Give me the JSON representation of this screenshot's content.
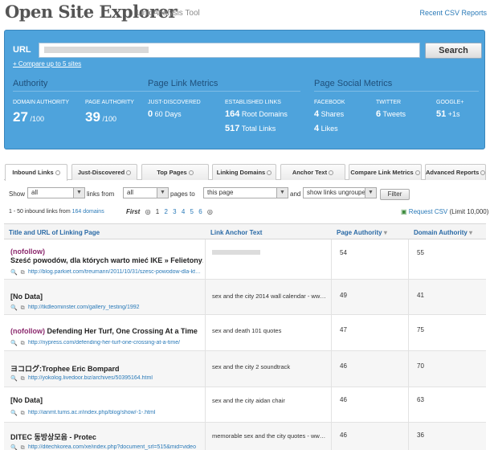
{
  "header": {
    "logo": "Open Site Explorer",
    "tagline": "Link Analysis Tool",
    "recent_csv": "Recent CSV Reports"
  },
  "search": {
    "url_label": "URL",
    "button": "Search",
    "compare": "+ Compare up to 5 sites"
  },
  "metrics": {
    "authority": {
      "title": "Authority",
      "domain_label": "DOMAIN AUTHORITY",
      "domain_value": "27",
      "domain_max": "/100",
      "page_label": "PAGE AUTHORITY",
      "page_value": "39",
      "page_max": "/100"
    },
    "page_link": {
      "title": "Page Link Metrics",
      "just_label": "JUST-DISCOVERED",
      "just_value": "0",
      "just_unit": "60 Days",
      "est_label": "ESTABLISHED LINKS",
      "root_value": "164",
      "root_unit": "Root Domains",
      "total_value": "517",
      "total_unit": "Total Links"
    },
    "social": {
      "title": "Page Social Metrics",
      "fb_label": "FACEBOOK",
      "fb_shares": "4",
      "fb_shares_unit": "Shares",
      "fb_likes": "4",
      "fb_likes_unit": "Likes",
      "tw_label": "TWITTER",
      "tw_value": "6",
      "tw_unit": "Tweets",
      "gp_label": "GOOGLE+",
      "gp_value": "51",
      "gp_unit": "+1s"
    }
  },
  "tabs": [
    "Inbound Links",
    "Just-Discovered",
    "Top Pages",
    "Linking Domains",
    "Anchor Text",
    "Compare Link Metrics",
    "Advanced Reports"
  ],
  "filters": {
    "show": "Show",
    "sel1": "all",
    "links_from": "links from",
    "sel2": "all",
    "pages_to": "pages to",
    "sel3": "this page",
    "and": "and",
    "sel4": "show links ungroupe",
    "filter_btn": "Filter"
  },
  "results": {
    "count_text": "1 - 50 inbound links from",
    "domains_link": "164 domains",
    "first": "First",
    "pages": [
      "1",
      "2",
      "3",
      "4",
      "5",
      "6"
    ],
    "request_csv": "Request CSV",
    "limit": "(Limit 10,000)"
  },
  "columns": [
    "Title and URL of Linking Page",
    "Link Anchor Text",
    "Page Authority",
    "Domain Authority"
  ],
  "rows": [
    {
      "prefix": "(nofollow)",
      "title": "Sześć powodów, dla których warto mieć IKE » Felietony…",
      "url": "http://blog.parkiet.com/treumann/2011/10/31/szesc-powodow-dla-kt…",
      "anchor": "",
      "pa": "54",
      "da": "55"
    },
    {
      "prefix": "",
      "title": "[No Data]",
      "url": "http://tkdleominster.com/gallery_testing/1992",
      "anchor": "sex and the city 2014 wall calendar - ww…",
      "pa": "49",
      "da": "41"
    },
    {
      "prefix": "(nofollow)",
      "title": "Defending Her Turf, One Crossing At a Time",
      "url": "http://nypress.com/defending-her-turf-one-crossing-at-a-time/",
      "anchor": "sex and death 101 quotes",
      "pa": "47",
      "da": "75"
    },
    {
      "prefix": "",
      "title": "ヨコログ:Trophee Eric Bompard",
      "url": "http://yokolog.livedoor.biz/archives/50395164.html",
      "anchor": "sex and the city 2 soundtrack",
      "pa": "46",
      "da": "70"
    },
    {
      "prefix": "",
      "title": "[No Data]",
      "url": "http://ianmt.tums.ac.ir/index.php/blog/show/-1-.html",
      "anchor": "sex and the city aidan chair",
      "pa": "46",
      "da": "63"
    },
    {
      "prefix": "",
      "title": "DITEC 동방상모음 - Protec",
      "url": "http://ditechkorea.com/xe/index.php?document_srl=515&mid=video",
      "anchor": "memorable sex and the city quotes - ww…",
      "pa": "46",
      "da": "36"
    }
  ]
}
